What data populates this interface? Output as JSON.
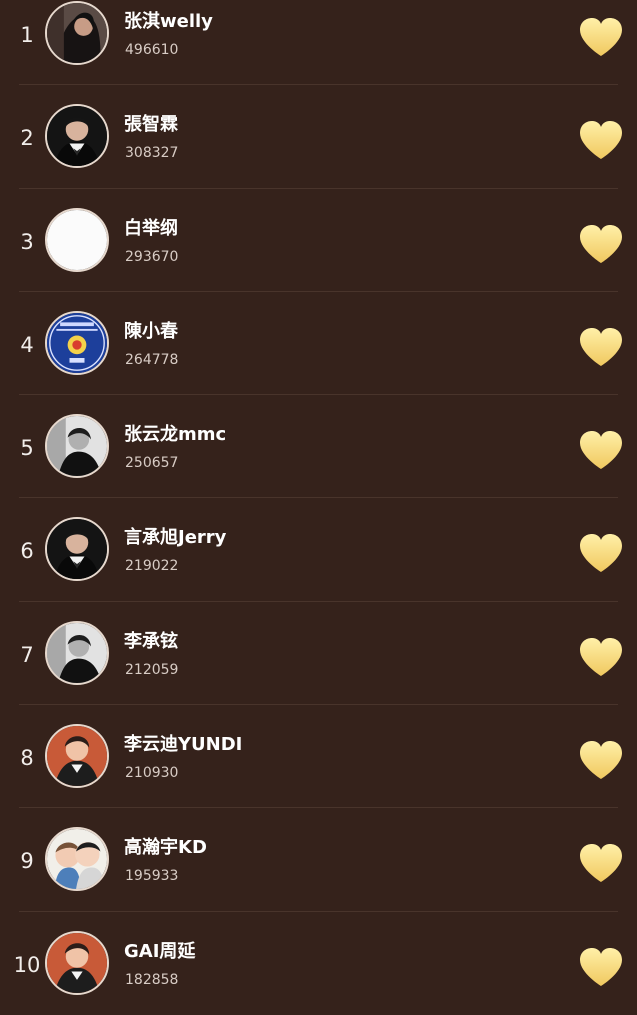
{
  "ranking": [
    {
      "rank": "1",
      "name": "张淇welly",
      "votes": "496610",
      "avatar": "photo-dark"
    },
    {
      "rank": "2",
      "name": "張智霖",
      "votes": "308327",
      "avatar": "suit"
    },
    {
      "rank": "3",
      "name": "白举纲",
      "votes": "293670",
      "avatar": "blank"
    },
    {
      "rank": "4",
      "name": "陳小春",
      "votes": "264778",
      "avatar": "passport"
    },
    {
      "rank": "5",
      "name": "张云龙mmc",
      "votes": "250657",
      "avatar": "monochrome"
    },
    {
      "rank": "6",
      "name": "言承旭Jerry",
      "votes": "219022",
      "avatar": "suit"
    },
    {
      "rank": "7",
      "name": "李承铉",
      "votes": "212059",
      "avatar": "monochrome"
    },
    {
      "rank": "8",
      "name": "李云迪YUNDI",
      "votes": "210930",
      "avatar": "red-background"
    },
    {
      "rank": "9",
      "name": "高瀚宇KD",
      "votes": "195933",
      "avatar": "cartoon"
    },
    {
      "rank": "10",
      "name": "GAI周延",
      "votes": "182858",
      "avatar": "red-background"
    }
  ],
  "colors": {
    "background": "#35221b",
    "divider": "#49342b",
    "heart_top": "#fff0a8",
    "heart_bottom": "#f0c85f"
  },
  "icons": {
    "vote": "heart-icon"
  }
}
